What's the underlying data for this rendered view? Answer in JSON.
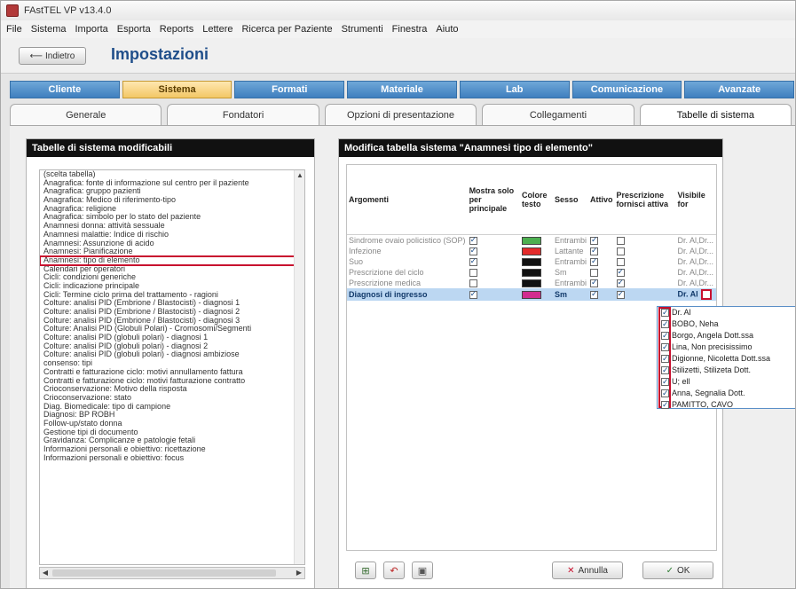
{
  "window": {
    "title": "FAstTEL VP v13.4.0"
  },
  "menu": [
    "File",
    "Sistema",
    "Importa",
    "Esporta",
    "Reports",
    "Lettere",
    "Ricerca per Paziente",
    "Strumenti",
    "Finestra",
    "Aiuto"
  ],
  "header": {
    "back_label": "Indietro",
    "page_title": "Impostazioni"
  },
  "main_tabs": [
    {
      "label": "Cliente",
      "active": false
    },
    {
      "label": "Sistema",
      "active": true
    },
    {
      "label": "Formati",
      "active": false
    },
    {
      "label": "Materiale",
      "active": false
    },
    {
      "label": "Lab",
      "active": false
    },
    {
      "label": "Comunicazione",
      "active": false
    },
    {
      "label": "Avanzate",
      "active": false
    }
  ],
  "sub_tabs": [
    {
      "label": "Generale",
      "active": false
    },
    {
      "label": "Fondatori",
      "active": false
    },
    {
      "label": "Opzioni di presentazione",
      "active": false
    },
    {
      "label": "Collegamenti",
      "active": false
    },
    {
      "label": "Tabelle di sistema",
      "active": true
    }
  ],
  "left_panel": {
    "title": "Tabelle di sistema modificabili",
    "items": [
      "(scelta tabella)",
      "Anagrafica: fonte di informazione sul centro per il paziente",
      "Anagrafica: gruppo pazienti",
      "Anagrafica: Medico di riferimento-tipo",
      "Anagrafica: religione",
      "Anagrafica: simbolo per lo stato del paziente",
      "Anamnesi donna: attività sessuale",
      "Anamnesi malattie: Indice di rischio",
      "Anamnesi: Assunzione di acido",
      "Anamnesi: Pianificazione",
      "Anamnesi: tipo di elemento",
      "Calendari per operatori",
      "Cicli: condizioni generiche",
      "Cicli: indicazione principale",
      "Cicli: Termine ciclo prima del trattamento - ragioni",
      "Colture: analisi PID (Embrione / Blastocisti) - diagnosi 1",
      "Colture: analisi PID (Embrione / Blastocisti) - diagnosi 2",
      "Colture: analisi PID (Embrione / Blastocisti) - diagnosi 3",
      "Colture: Analisi PID (Globuli Polari) - Cromosomi/Segmenti",
      "Colture: analisi PID (globuli polari) - diagnosi 1",
      "Colture: analisi PID (globuli polari) - diagnosi 2",
      "Colture: analisi PID (globuli polari) - diagnosi ambiziose",
      "consenso: tipi",
      "Contratti e fatturazione ciclo: motivi annullamento fattura",
      "Contratti e fatturazione ciclo: motivi fatturazione contratto",
      "Crioconservazione: Motivo della risposta",
      "Crioconservazione: stato",
      "Diag. Biomedicale: tipo di campione",
      "Diagnosi: BP ROBH",
      "Follow-up/stato donna",
      "Gestione tipi di documento",
      "Gravidanza: Complicanze e patologie fetali",
      "Informazioni personali e obiettivo: ricettazione",
      "Informazioni personali e obiettivo: focus"
    ],
    "selected_index": 10
  },
  "right_panel": {
    "title": "Modifica tabella sistema \"Anamnesi tipo di elemento\"",
    "columns": [
      "Argomenti",
      "Mostra solo per principale",
      "Colore testo",
      "Sesso",
      "Attivo",
      "Prescrizione fornisci attiva",
      "Visibile for"
    ],
    "rows": [
      {
        "name": "Sindrome ovaio policistico (SOP)",
        "main": true,
        "color": "#4caf50",
        "sex": "Entrambi",
        "active": true,
        "presc": false,
        "visible": "Dr. Al,Dr..."
      },
      {
        "name": "Infezione",
        "main": true,
        "color": "#e32b2b",
        "sex": "Lattante",
        "active": true,
        "presc": false,
        "visible": "Dr. Al,Dr..."
      },
      {
        "name": "Suo",
        "main": true,
        "color": "#111111",
        "sex": "Entrambi",
        "active": true,
        "presc": false,
        "visible": "Dr. Al,Dr..."
      },
      {
        "name": "Prescrizione del ciclo",
        "main": false,
        "color": "#111111",
        "sex": "Sm",
        "active": false,
        "presc": true,
        "visible": "Dr. Al,Dr..."
      },
      {
        "name": "Prescrizione medica",
        "main": false,
        "color": "#111111",
        "sex": "Entrambi",
        "active": true,
        "presc": true,
        "visible": "Dr. Al,Dr..."
      },
      {
        "name": "Diagnosi di ingresso",
        "main": true,
        "color": "#d12c8f",
        "sex": "Sm",
        "active": true,
        "presc": true,
        "visible": "Dr. Al"
      }
    ],
    "selected_row": 5,
    "buttons": {
      "cancel": "Annulla",
      "ok": "OK"
    }
  },
  "dropdown": {
    "items": [
      {
        "label": "Dr. Al",
        "checked": true
      },
      {
        "label": "BOBO, Neha",
        "checked": true
      },
      {
        "label": "Borgo, Angela Dott.ssa",
        "checked": true
      },
      {
        "label": "Lina, Non precisissimo",
        "checked": true
      },
      {
        "label": "Digionne, Nicoletta Dott.ssa",
        "checked": true
      },
      {
        "label": "Stilizetti, Stilizeta Dott.",
        "checked": true
      },
      {
        "label": "U; ell",
        "checked": true
      },
      {
        "label": "Anna, Segnalia Dott.",
        "checked": true
      },
      {
        "label": "PAMITTO, CAVO",
        "checked": true
      }
    ]
  },
  "colors": {
    "accent": "#3f7fbf",
    "active_tab": "#f3c766",
    "highlight": "#c8102e",
    "selected_row": "#bcd7f2"
  }
}
